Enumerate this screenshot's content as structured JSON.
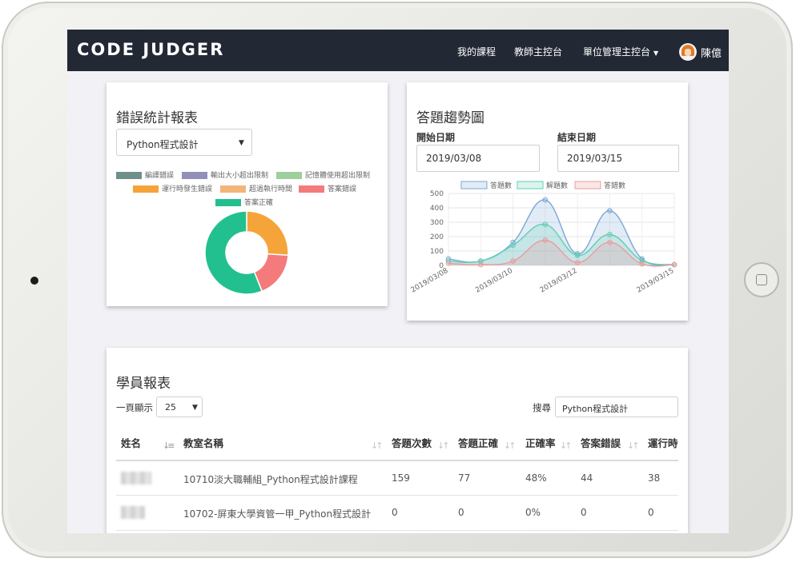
{
  "nav": {
    "brand": "CODE JUDGER",
    "items": [
      "我的課程",
      "教師主控台",
      "單位管理主控台"
    ],
    "user": "陳億"
  },
  "error_report": {
    "title": "錯誤統計報表",
    "course": "Python程式設計",
    "legend": [
      {
        "label": "編譯錯誤",
        "color": "#6f8f8a"
      },
      {
        "label": "輸出大小超出限制",
        "color": "#9090b8"
      },
      {
        "label": "記憶體使用超出限制",
        "color": "#9fcf9c"
      },
      {
        "label": "運行時發生錯誤",
        "color": "#f5a43a"
      },
      {
        "label": "超過執行時間",
        "color": "#f2b57a"
      },
      {
        "label": "答案錯誤",
        "color": "#f47b7b"
      },
      {
        "label": "答案正確",
        "color": "#23c08f"
      }
    ]
  },
  "trend": {
    "title": "答題趨勢圖",
    "start_label": "開始日期",
    "start_value": "2019/03/08",
    "end_label": "結束日期",
    "end_value": "2019/03/15",
    "colors": {
      "answers": "#7aa7d6",
      "solved": "#5fcfb0",
      "wrong": "#ef9a9a"
    }
  },
  "chart_data": [
    {
      "type": "pie",
      "title": "錯誤統計報表",
      "labels": [
        "編譯錯誤",
        "輸出大小超出限制",
        "記憶體使用超出限制",
        "運行時發生錯誤",
        "超過執行時間",
        "答案錯誤",
        "答案正確"
      ],
      "values": [
        0,
        0,
        0,
        26,
        0,
        18,
        56
      ],
      "colors": [
        "#6f8f8a",
        "#9090b8",
        "#9fcf9c",
        "#f5a43a",
        "#f2b57a",
        "#f47b7b",
        "#23c08f"
      ]
    },
    {
      "type": "area",
      "x": [
        "2019/03/08",
        "2019/03/09",
        "2019/03/10",
        "2019/03/11",
        "2019/03/12",
        "2019/03/13",
        "2019/03/14",
        "2019/03/15"
      ],
      "x_tick_labels": [
        "2019/03/08",
        "2019/03/10",
        "2019/03/12",
        "2019/03/15"
      ],
      "ylim": [
        0,
        500
      ],
      "yticks": [
        0,
        100,
        200,
        300,
        400,
        500
      ],
      "series": [
        {
          "name": "答題數",
          "values": [
            45,
            30,
            160,
            455,
            80,
            380,
            45,
            5
          ]
        },
        {
          "name": "解題數",
          "values": [
            30,
            30,
            140,
            285,
            70,
            215,
            35,
            5
          ]
        },
        {
          "name": "答錯數",
          "values": [
            15,
            5,
            30,
            175,
            20,
            160,
            10,
            5
          ]
        }
      ],
      "grid": true,
      "legend": "top"
    }
  ],
  "students": {
    "title": "學員報表",
    "page_size_label": "一頁顯示",
    "page_size": "25",
    "search_label": "搜尋",
    "search_value": "Python程式設計",
    "headers": [
      "姓名",
      "教室名稱",
      "答題次數",
      "答題正確",
      "正確率",
      "答案錯誤",
      "運行時"
    ],
    "rows": [
      [
        "10710淡大職輔組_Python程式設計課程",
        "159",
        "77",
        "48%",
        "44",
        "38"
      ],
      [
        "10702-屏東大學資管一甲_Python程式設計",
        "0",
        "0",
        "0%",
        "0",
        "0"
      ]
    ]
  }
}
